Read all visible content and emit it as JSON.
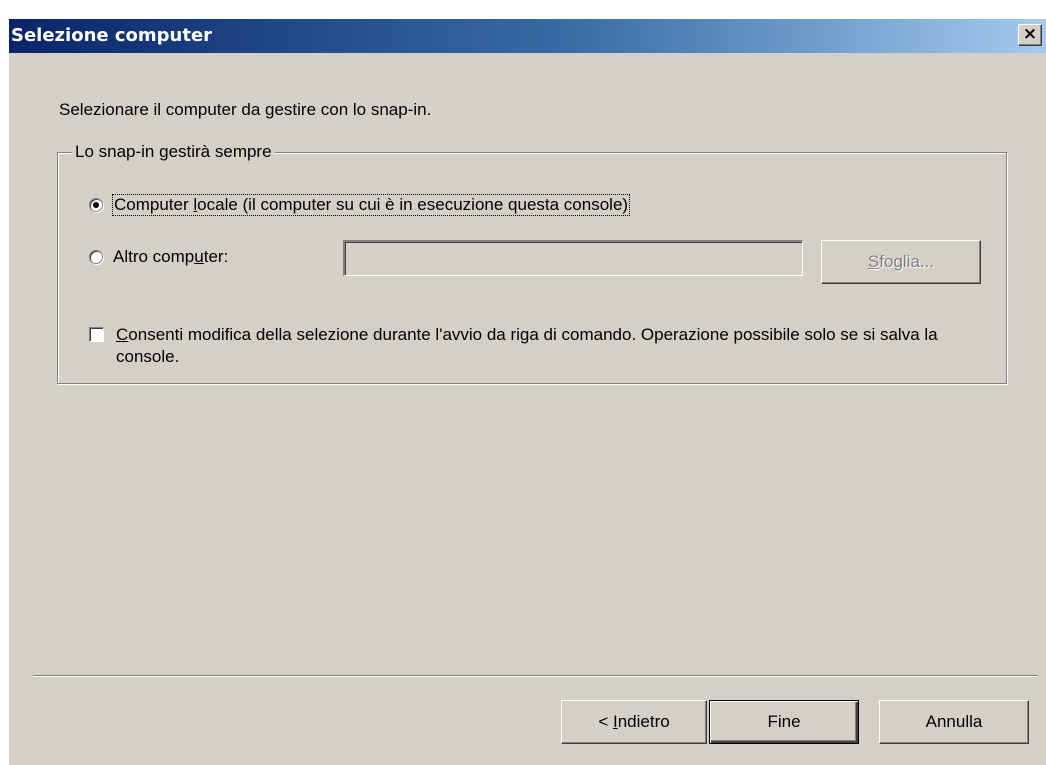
{
  "window": {
    "title": "Selezione computer",
    "close_glyph": "×"
  },
  "intro_text": "Selezionare il computer da gestire con lo snap-in.",
  "group": {
    "legend": "Lo snap-in gestirà sempre",
    "options": [
      {
        "label_pre": "Computer ",
        "label_accel": "l",
        "label_post": "ocale (il computer su cui è in esecuzione questa console)",
        "selected": true
      },
      {
        "label_pre": "Altro comp",
        "label_accel": "u",
        "label_post": "ter:",
        "selected": false
      }
    ],
    "other_computer_value": "",
    "browse_button": {
      "accel": "S",
      "rest": "foglia...",
      "enabled": false
    },
    "allow_change_checkbox": {
      "accel": "C",
      "rest": "onsenti modifica della selezione durante l'avvio da riga di comando. Operazione possibile solo se si salva la console.",
      "checked": false
    }
  },
  "footer": {
    "back_button": {
      "pre": "< ",
      "accel": "I",
      "rest": "ndietro"
    },
    "finish_button": "Fine",
    "cancel_button": "Annulla"
  },
  "colors": {
    "dialog_bg": "#d4d0c8",
    "title_gradient_start": "#0a246a",
    "title_gradient_end": "#a6caf0"
  }
}
